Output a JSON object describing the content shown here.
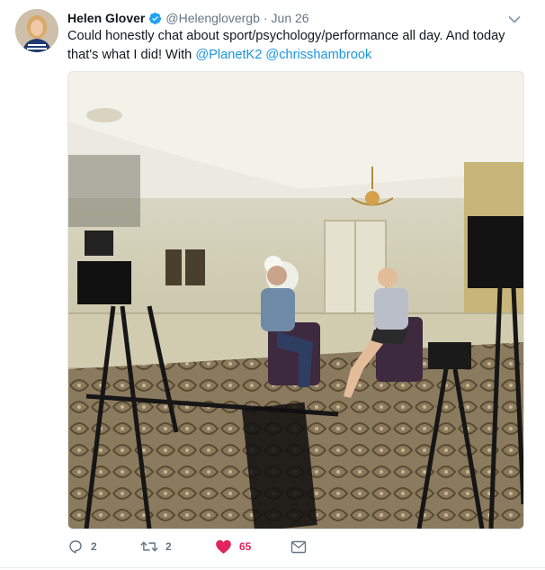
{
  "tweet": {
    "author_name": "Helen Glover",
    "handle": "@Helenglovergb",
    "separator": "·",
    "date": "Jun 26",
    "text_main": "Could honestly chat about sport/psychology/performance all day. And today that's what I did! With",
    "mention_1": "@PlanetK2",
    "mention_2": "@chrisshambrook",
    "verified": true
  },
  "actions": {
    "reply_count": "2",
    "retweet_count": "2",
    "like_count": "65",
    "liked": true
  },
  "icons": {
    "verified": "verified-badge-icon",
    "caret": "chevron-down-icon",
    "reply": "reply-icon",
    "retweet": "retweet-icon",
    "like": "heart-icon",
    "dm": "envelope-icon"
  },
  "colors": {
    "link": "#1b95e0",
    "like": "#e0245e",
    "muted": "#657786",
    "verified": "#1da1f2"
  }
}
